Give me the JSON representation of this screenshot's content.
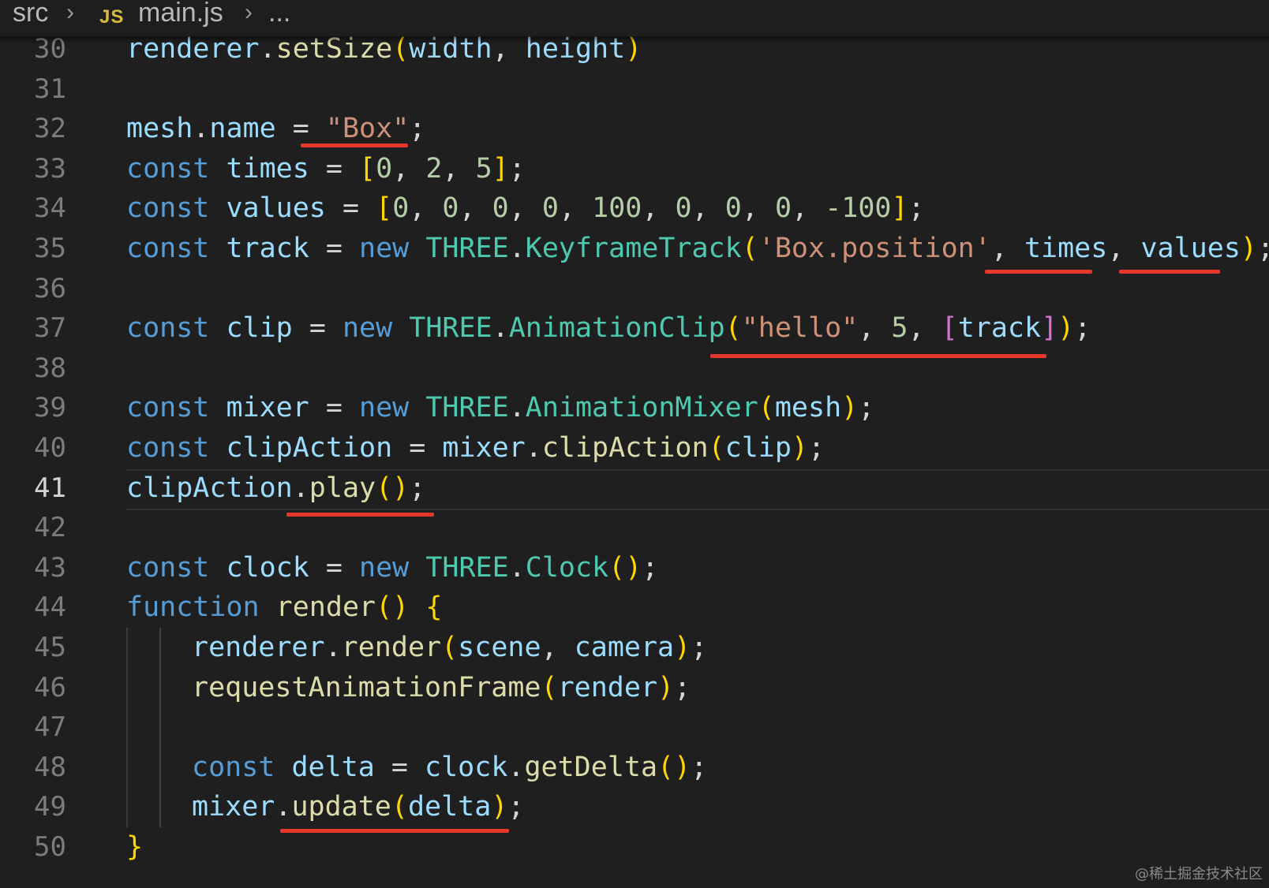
{
  "breadcrumb": {
    "folder": "src",
    "file_icon": "JS",
    "file": "main.js",
    "ellipsis": "..."
  },
  "editor": {
    "active_line": "41",
    "lines": [
      {
        "num": "30",
        "text": "renderer.setSize(width, height)"
      },
      {
        "num": "31",
        "text": ""
      },
      {
        "num": "32",
        "text": "mesh.name = \"Box\";"
      },
      {
        "num": "33",
        "text": "const times = [0, 2, 5];"
      },
      {
        "num": "34",
        "text": "const values = [0, 0, 0, 0, 100, 0, 0, 0, -100];"
      },
      {
        "num": "35",
        "text": "const track = new THREE.KeyframeTrack('Box.position', times, values);"
      },
      {
        "num": "36",
        "text": ""
      },
      {
        "num": "37",
        "text": "const clip = new THREE.AnimationClip(\"hello\", 5, [track]);"
      },
      {
        "num": "38",
        "text": ""
      },
      {
        "num": "39",
        "text": "const mixer = new THREE.AnimationMixer(mesh);"
      },
      {
        "num": "40",
        "text": "const clipAction = mixer.clipAction(clip);"
      },
      {
        "num": "41",
        "text": "clipAction.play();"
      },
      {
        "num": "42",
        "text": ""
      },
      {
        "num": "43",
        "text": "const clock = new THREE.Clock();"
      },
      {
        "num": "44",
        "text": "function render() {"
      },
      {
        "num": "45",
        "text": "renderer.render(scene, camera);"
      },
      {
        "num": "46",
        "text": "requestAnimationFrame(render);"
      },
      {
        "num": "47",
        "text": ""
      },
      {
        "num": "48",
        "text": "const delta = clock.getDelta();"
      },
      {
        "num": "49",
        "text": "mixer.update(delta);"
      },
      {
        "num": "50",
        "text": "}"
      }
    ]
  },
  "colors": {
    "background": "#1f1f1f",
    "variable": "#9cdcfe",
    "keyword": "#569cd6",
    "function": "#dcdcaa",
    "class": "#4ec9b0",
    "string": "#ce9178",
    "number": "#b5cea8",
    "annotation_underline": "#e8382b"
  },
  "watermark": "@稀土掘金技术社区"
}
